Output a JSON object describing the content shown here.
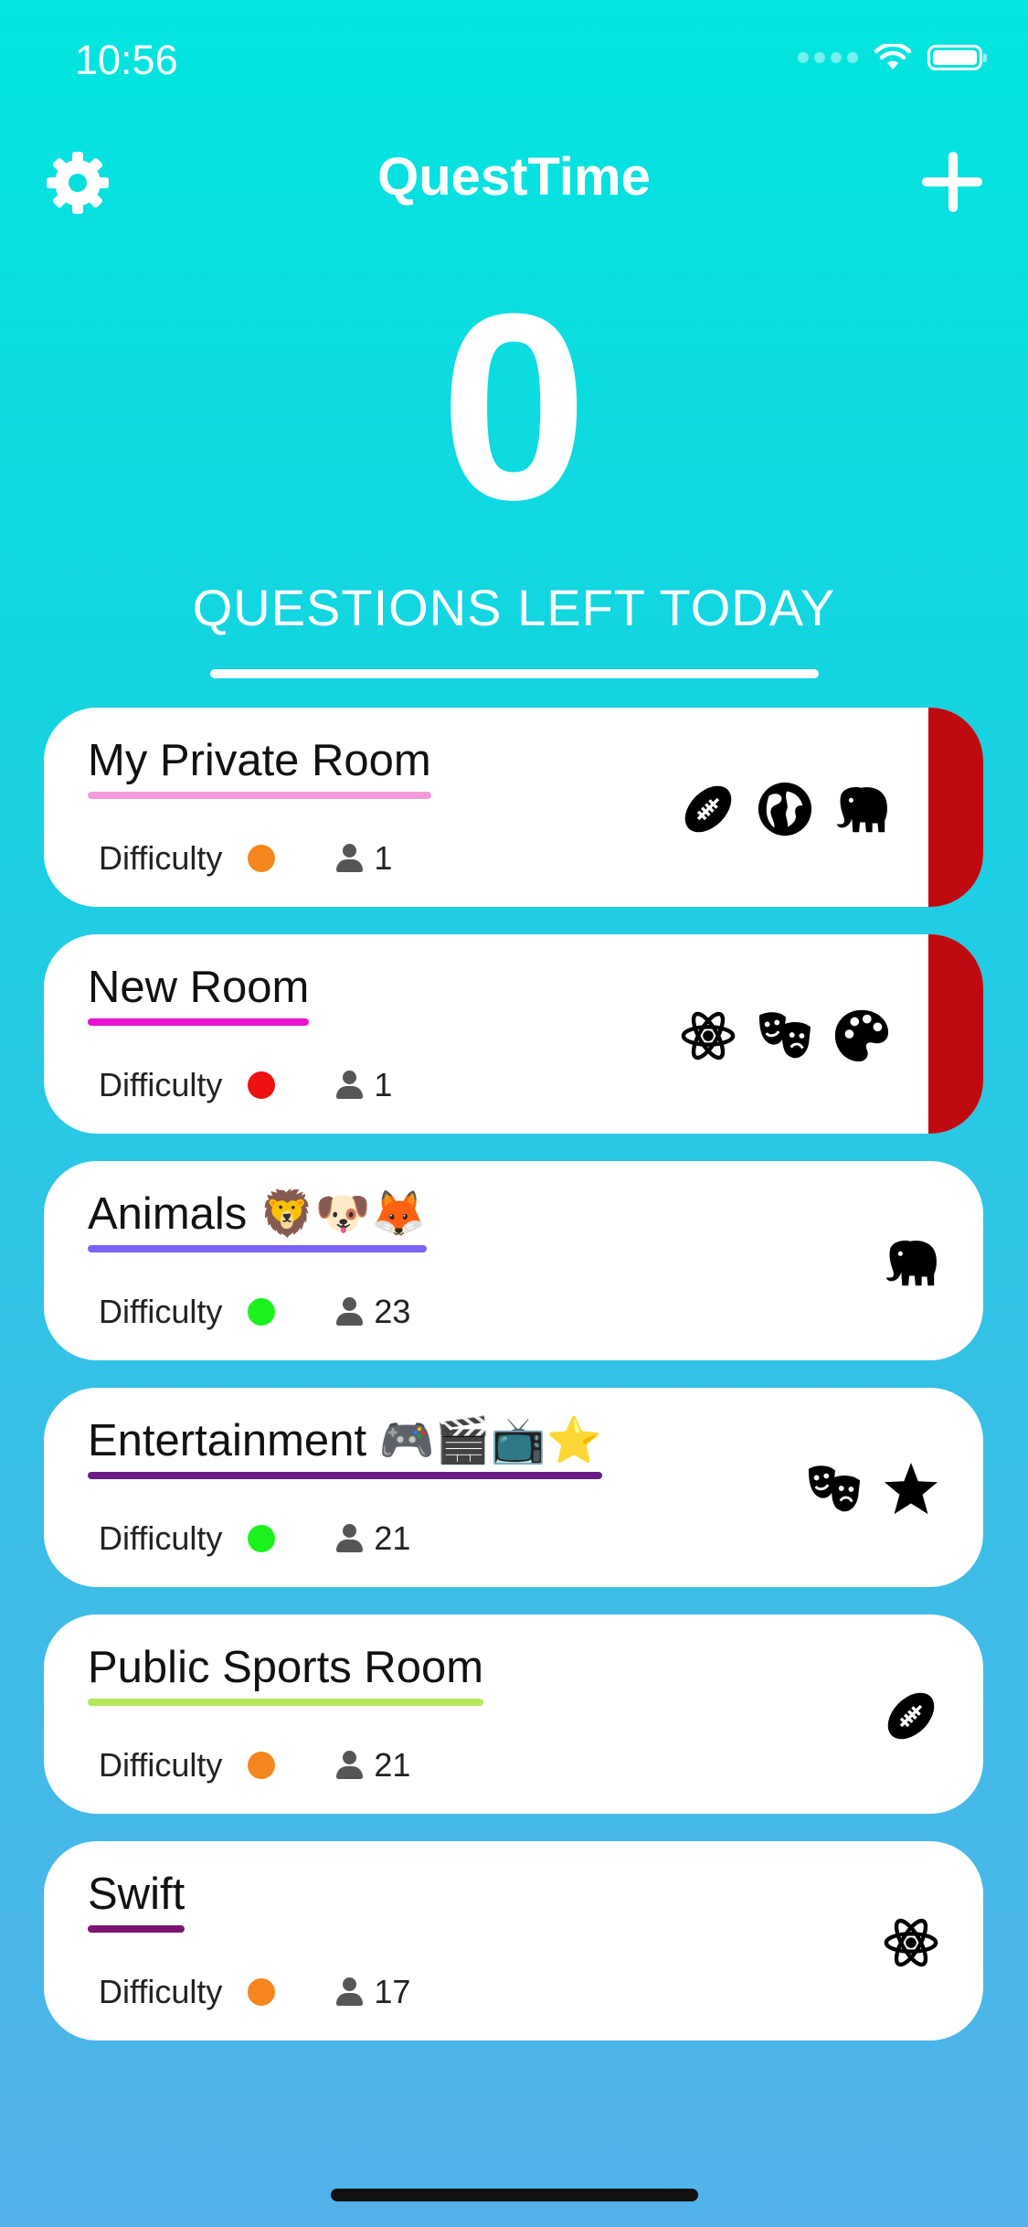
{
  "status_bar": {
    "time": "10:56"
  },
  "header": {
    "title": "QuestTime"
  },
  "counter": {
    "value": "0",
    "label": "QUESTIONS LEFT TODAY"
  },
  "difficulty_label": "Difficulty",
  "colors": {
    "accent_red": "#bf0a10",
    "orange": "#f5861f",
    "red": "#ee1111",
    "green": "#1df11d"
  },
  "rooms": [
    {
      "name": "My Private Room",
      "members": "1",
      "difficulty": "orange",
      "underline": "#f19ad9",
      "accent": true,
      "icons": [
        "football-icon",
        "globe-icon",
        "elephant-icon"
      ]
    },
    {
      "name": "New Room",
      "members": "1",
      "difficulty": "red",
      "underline": "#e812d0",
      "accent": true,
      "icons": [
        "atom-icon",
        "theater-masks-icon",
        "palette-icon"
      ]
    },
    {
      "name": "Animals 🦁🐶🦊",
      "members": "23",
      "difficulty": "green",
      "underline": "#7a64f2",
      "accent": false,
      "icons": [
        "elephant-icon"
      ]
    },
    {
      "name": "Entertainment 🎮🎬📺⭐",
      "members": "21",
      "difficulty": "green",
      "underline": "#6a1d86",
      "accent": false,
      "icons": [
        "theater-masks-icon",
        "star-icon"
      ]
    },
    {
      "name": "Public Sports Room",
      "members": "21",
      "difficulty": "orange",
      "underline": "#b6e65c",
      "accent": false,
      "icons": [
        "football-icon"
      ]
    },
    {
      "name": "Swift",
      "members": "17",
      "difficulty": "orange",
      "underline": "#7a1672",
      "accent": false,
      "icons": [
        "atom-icon"
      ]
    }
  ]
}
